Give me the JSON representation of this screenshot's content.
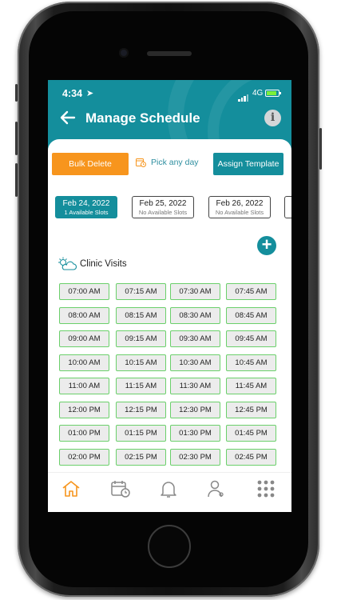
{
  "status": {
    "time": "4:34",
    "network": "4G"
  },
  "header": {
    "title": "Manage Schedule",
    "back_icon": "arrow-left-icon",
    "info_label": "i"
  },
  "toolbar": {
    "bulk_delete": "Bulk Delete",
    "pick_any_day": "Pick any day",
    "assign_template": "Assign Template"
  },
  "dates": [
    {
      "date": "Feb 24, 2022",
      "slots": "1 Available Slots",
      "active": true
    },
    {
      "date": "Feb 25, 2022",
      "slots": "No Available Slots",
      "active": false
    },
    {
      "date": "Feb 26, 2022",
      "slots": "No Available Slots",
      "active": false
    }
  ],
  "section": {
    "title": "Clinic Visits"
  },
  "slots": [
    "07:00 AM",
    "07:15 AM",
    "07:30 AM",
    "07:45 AM",
    "08:00 AM",
    "08:15 AM",
    "08:30 AM",
    "08:45 AM",
    "09:00 AM",
    "09:15 AM",
    "09:30 AM",
    "09:45 AM",
    "10:00 AM",
    "10:15 AM",
    "10:30 AM",
    "10:45 AM",
    "11:00 AM",
    "11:15 AM",
    "11:30 AM",
    "11:45 AM",
    "12:00 PM",
    "12:15 PM",
    "12:30 PM",
    "12:45 PM",
    "01:00 PM",
    "01:15 PM",
    "01:30 PM",
    "01:45 PM",
    "02:00 PM",
    "02:15 PM",
    "02:30 PM",
    "02:45 PM"
  ],
  "bottom_nav": [
    "home-icon",
    "calendar-clock-icon",
    "bell-icon",
    "doctor-profile-icon",
    "apps-grid-icon"
  ],
  "colors": {
    "primary": "#148e9c",
    "accent": "#f7951d",
    "slot_border": "#6bd06b"
  }
}
